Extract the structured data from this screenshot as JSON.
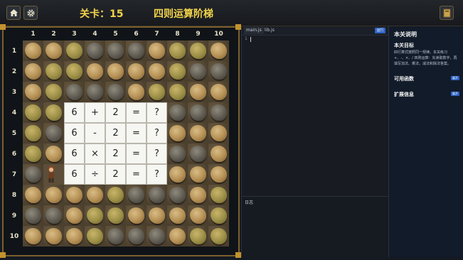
{
  "header": {
    "home_icon": "home-icon",
    "settings_icon": "gear-icon",
    "level_label": "关卡：15",
    "game_title": "四则运算阶梯",
    "book_icon": "book-icon"
  },
  "board": {
    "columns": [
      "1",
      "2",
      "3",
      "4",
      "5",
      "6",
      "7",
      "8",
      "9",
      "10"
    ],
    "rows": [
      "1",
      "2",
      "3",
      "4",
      "5",
      "6",
      "7",
      "8",
      "9",
      "10"
    ],
    "equations": [
      [
        "6",
        "+",
        "2",
        "=",
        "?"
      ],
      [
        "6",
        "-",
        "2",
        "=",
        "?"
      ],
      [
        "6",
        "×",
        "2",
        "=",
        "?"
      ],
      [
        "6",
        "÷",
        "2",
        "=",
        "?"
      ]
    ]
  },
  "editor": {
    "tabs": [
      "main.js",
      "lib.js"
    ],
    "run_label": "运行",
    "line_number": "1",
    "console_label": "日志"
  },
  "panel": {
    "title": "本关说明",
    "goal_heading": "本关目标",
    "goal_text": "四行算式按照同一规律。本关练习 +、-、×、/ 四则运算：先读取数字，再填写加法、乘法，减法和除法答案。",
    "functions_heading": "可用函数",
    "functions_btn": "展开",
    "extra_heading": "扩展信息",
    "extra_btn": "展开"
  },
  "colors": {
    "title_yellow": "#f1d34a",
    "frame_gold": "#7a5f2e",
    "accent_blue": "#2d63c8"
  }
}
